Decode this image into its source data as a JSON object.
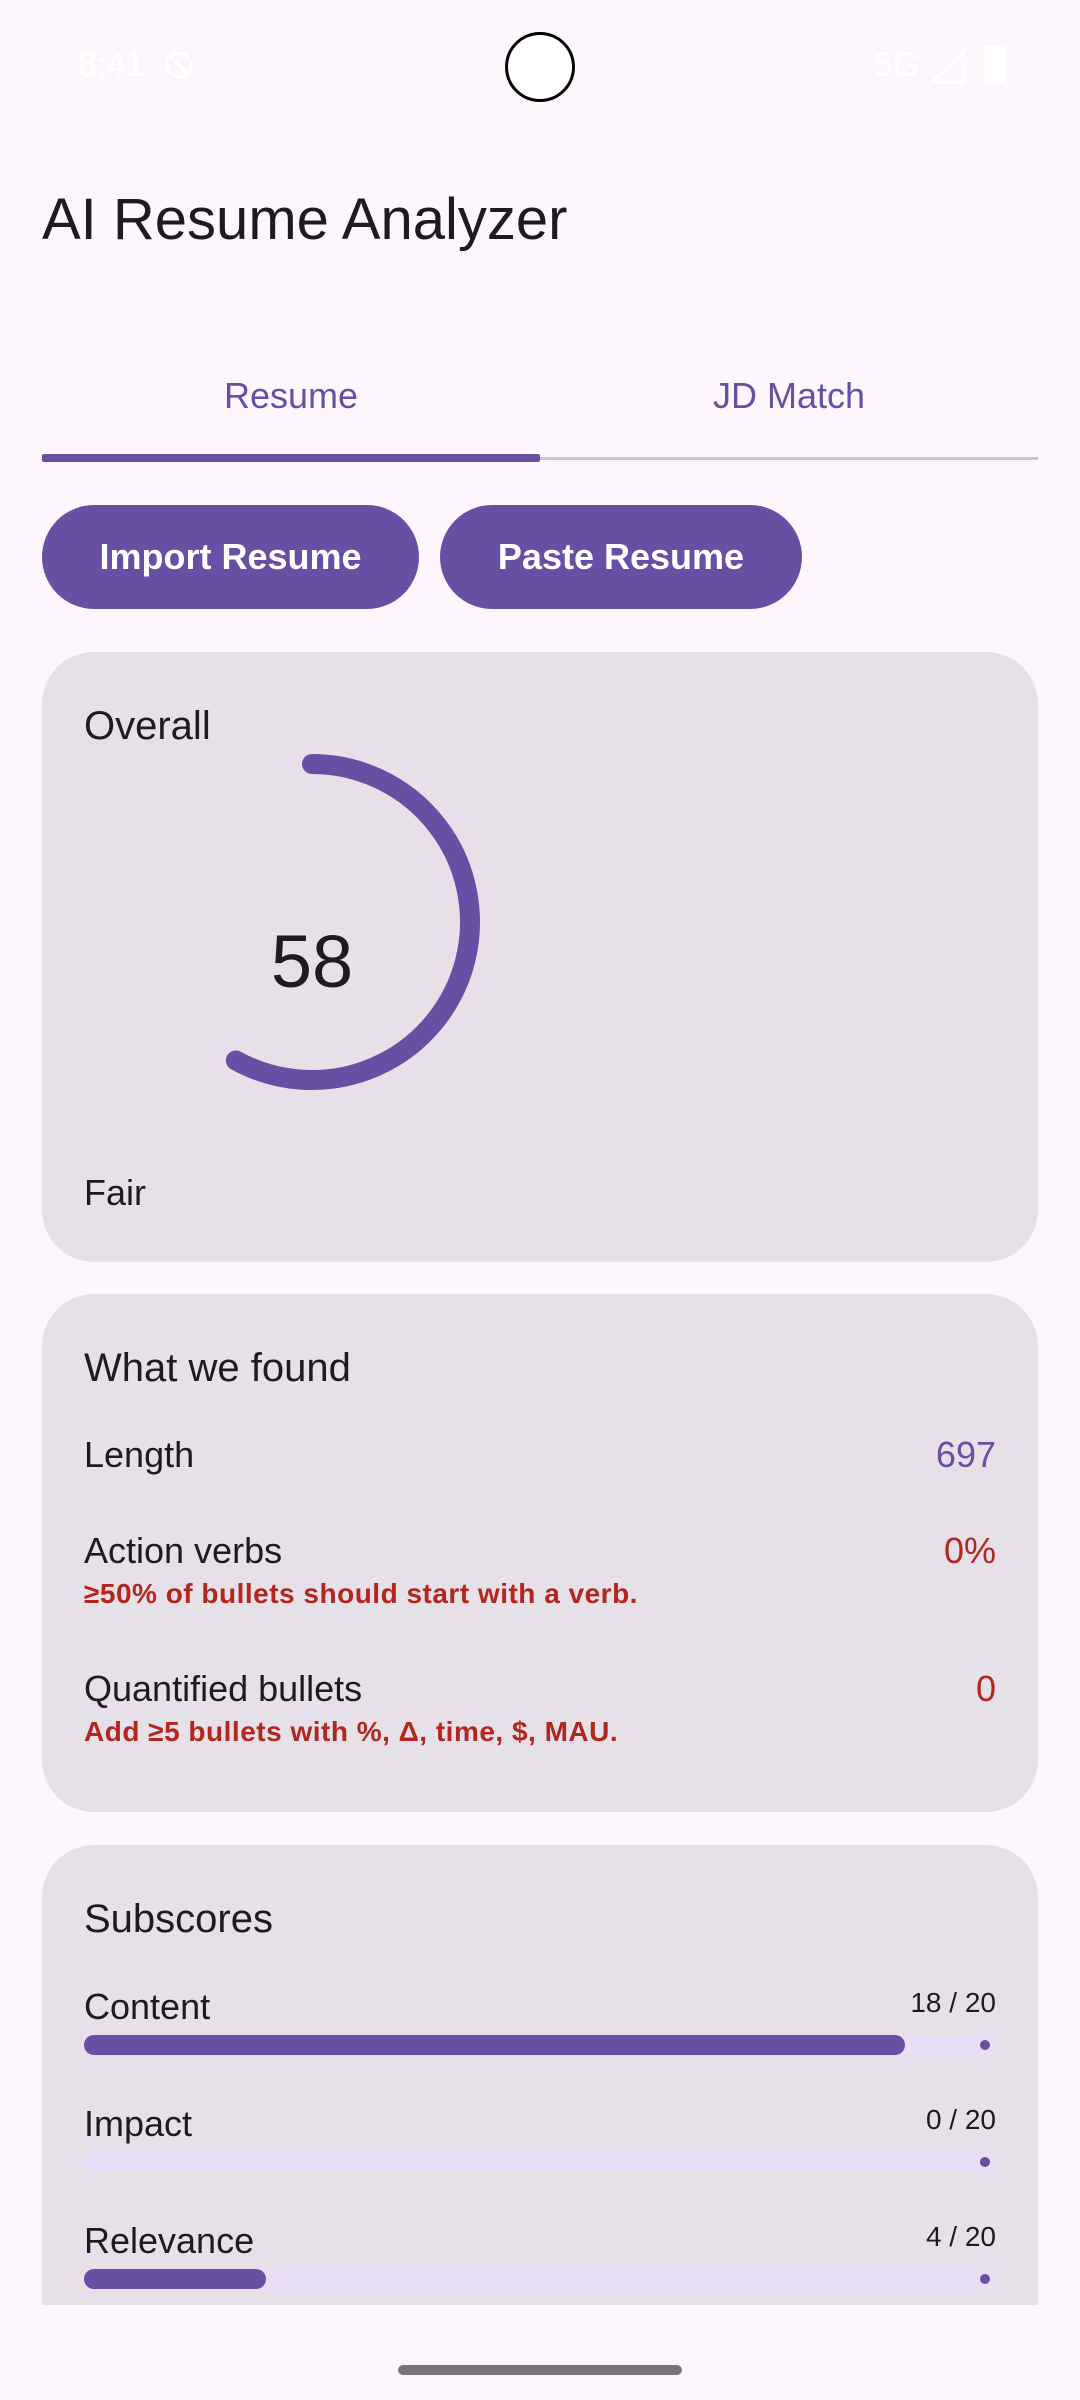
{
  "status_bar": {
    "time": "8:41",
    "network": "5G",
    "dnd_icon": "dnd-icon",
    "signal_icon": "signal-icon",
    "battery_icon": "battery-icon"
  },
  "app": {
    "title": "AI Resume Analyzer"
  },
  "tabs": [
    {
      "label": "Resume",
      "selected": true
    },
    {
      "label": "JD Match",
      "selected": false
    }
  ],
  "actions": {
    "import_label": "Import Resume",
    "paste_label": "Paste Resume"
  },
  "overall": {
    "title": "Overall",
    "score": "58",
    "score_fraction": 0.58,
    "rating": "Fair"
  },
  "found": {
    "title": "What we found",
    "rows": [
      {
        "label": "Length",
        "value": "697",
        "hint": ""
      },
      {
        "label": "Action verbs",
        "value": "0%",
        "hint": "≥50% of bullets should start with a verb."
      },
      {
        "label": "Quantified bullets",
        "value": "0",
        "hint": "Add ≥5 bullets with %, Δ, time, $, MAU."
      }
    ]
  },
  "subscores": {
    "title": "Subscores",
    "items": [
      {
        "label": "Content",
        "score": "18 / 20",
        "fraction": 0.9
      },
      {
        "label": "Impact",
        "score": "0 / 20",
        "fraction": 0.0
      },
      {
        "label": "Relevance",
        "score": "4 / 20",
        "fraction": 0.2
      }
    ]
  },
  "colors": {
    "accent": "#6750a4",
    "card": "#e6e0e9",
    "warning": "#b3261e",
    "background": "#fdf7fd",
    "track": "#e8def8"
  }
}
